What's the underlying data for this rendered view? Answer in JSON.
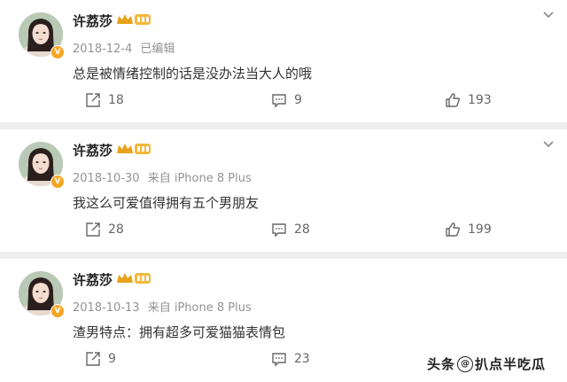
{
  "comments": [
    {
      "user": "许荔莎",
      "date": "2018-12-4",
      "source": "已编辑",
      "text": "总是被情绪控制的话是没办法当大人的哦",
      "reposts": "18",
      "replies": "9",
      "likes": "193"
    },
    {
      "user": "许荔莎",
      "date": "2018-10-30",
      "source": "来自 iPhone 8 Plus",
      "text": "我这么可爱值得拥有五个男朋友",
      "reposts": "28",
      "replies": "28",
      "likes": "199"
    },
    {
      "user": "许荔莎",
      "date": "2018-10-13",
      "source": "来自 iPhone 8 Plus",
      "text": "渣男特点：拥有超多可爱猫猫表情包",
      "reposts": "9",
      "replies": "23",
      "likes": ""
    }
  ],
  "icons": {
    "avatar": "avatar",
    "verified": "verified-badge-icon",
    "crown": "crown-badge-icon",
    "repost": "repost-icon",
    "reply": "comment-icon",
    "like": "thumbs-up-icon",
    "more": "chevron-down-icon"
  },
  "watermark": {
    "prefix": "头条",
    "handle": "扒点半吃瓜"
  },
  "colors": {
    "badge": "#f5a623",
    "meta": "#939393",
    "background": "#eeeeee"
  }
}
